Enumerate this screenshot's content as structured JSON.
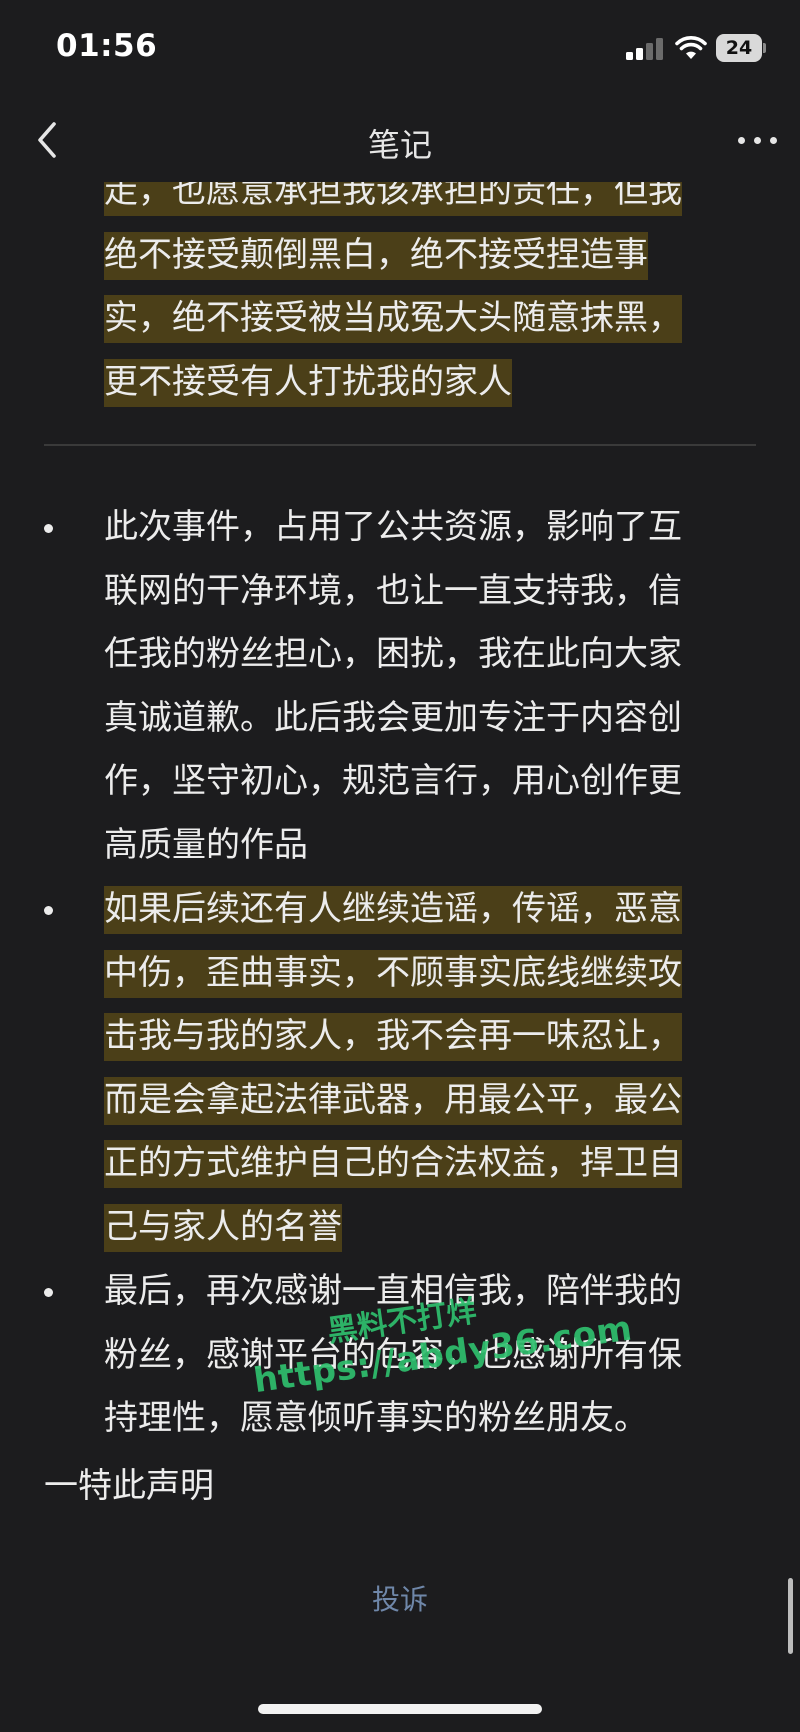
{
  "status_bar": {
    "time": "01:56",
    "battery": "24",
    "icons": [
      "signal-icon",
      "wifi-icon",
      "battery-icon"
    ]
  },
  "nav": {
    "title": "笔记",
    "back_icon": "chevron-left-icon",
    "more_icon": "more-dots-icon"
  },
  "colors": {
    "background": "#1c1c1e",
    "highlight": "#4b3f18",
    "text": "#ececec",
    "link": "#6f87a9",
    "watermark": "#2fbf6e"
  },
  "top_paragraph": {
    "lines": [
      "走，也愿意承担我该承担的责任，但我",
      "绝不接受颠倒黑白，绝不接受捏造事",
      "实，绝不接受被当成冤大头随意抹黑，",
      "更不接受有人打扰我的家人"
    ]
  },
  "bullets": [
    {
      "highlighted": false,
      "lines": [
        "此次事件，占用了公共资源，影响了互",
        "联网的干净环境，也让一直支持我，信",
        "任我的粉丝担心，困扰，我在此向大家",
        "真诚道歉。此后我会更加专注于内容创",
        "作，坚守初心，规范言行，用心创作更",
        "高质量的作品"
      ]
    },
    {
      "highlighted": true,
      "lines": [
        "如果后续还有人继续造谣，传谣，恶意",
        "中伤，歪曲事实，不顾事实底线继续攻",
        "击我与我的家人，我不会再一味忍让，",
        "而是会拿起法律武器，用最公平，最公",
        "正的方式维护自己的合法权益，捍卫自",
        "己与家人的名誉"
      ]
    },
    {
      "highlighted": false,
      "lines": [
        "最后，再次感谢一直相信我，陪伴我的",
        "粉丝，感谢平台的包容，也感谢所有保",
        "持理性，愿意倾听事实的粉丝朋友。"
      ]
    }
  ],
  "closing": "一特此声明",
  "watermark": {
    "line1": "黑料不打烊",
    "line2": "https://abdy36.com"
  },
  "complaint_label": "投诉"
}
